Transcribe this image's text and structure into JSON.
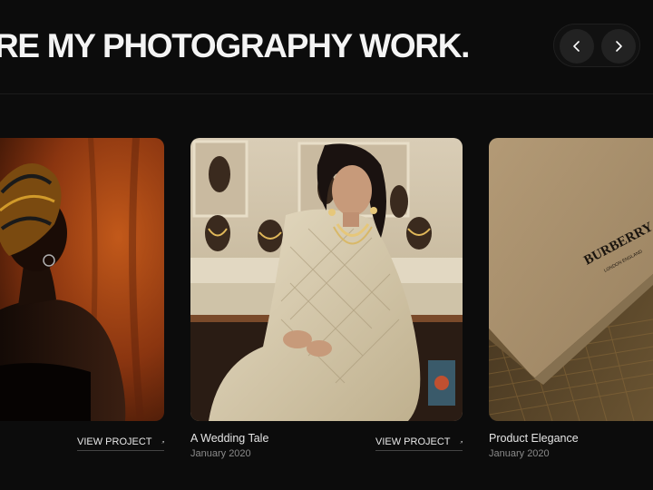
{
  "header": {
    "headline": "RE MY PHOTOGRAPHY WORK."
  },
  "nav": {
    "prev_icon": "chevron-left-icon",
    "next_icon": "chevron-right-icon"
  },
  "projects": [
    {
      "image": "portrait-woman-headwrap",
      "title": "",
      "date": "",
      "link_label": "VIEW PROJECT",
      "link_icon": "arrow-up-right-icon"
    },
    {
      "image": "wedding-bride-jewelry",
      "title": "A Wedding Tale",
      "date": "January 2020",
      "link_label": "VIEW PROJECT",
      "link_icon": "arrow-up-right-icon"
    },
    {
      "image": "burberry-product-box",
      "title": "Product Elegance",
      "date": "January 2020",
      "box_brand": "BURBERRY",
      "box_subtext": "LONDON ENGLAND"
    }
  ],
  "colors": {
    "background": "#0c0c0c",
    "text": "#ffffff",
    "muted_text": "#8a8a8a",
    "nav_button": "#222222"
  }
}
